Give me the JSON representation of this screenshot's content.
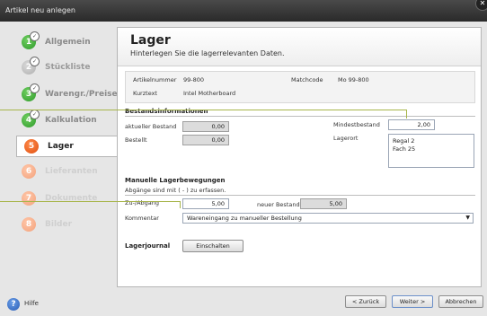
{
  "window": {
    "title": "Artikel neu anlegen"
  },
  "sidebar": {
    "items": [
      {
        "num": "1",
        "label": "Allgemein",
        "state": "done"
      },
      {
        "num": "2",
        "label": "Stückliste",
        "state": "done-grey"
      },
      {
        "num": "3",
        "label": "Warengr./Preise",
        "state": "done"
      },
      {
        "num": "4",
        "label": "Kalkulation",
        "state": "done"
      },
      {
        "num": "5",
        "label": "Lager",
        "state": "current"
      },
      {
        "num": "6",
        "label": "Lieferanten",
        "state": "future"
      },
      {
        "num": "7",
        "label": "Dokumente",
        "state": "future"
      },
      {
        "num": "8",
        "label": "Bilder",
        "state": "future"
      }
    ]
  },
  "header": {
    "title": "Lager",
    "subtitle": "Hinterlegen Sie die lagerrelevanten Daten."
  },
  "article": {
    "number_label": "Artikelnummer",
    "number_value": "99-800",
    "matchcode_label": "Matchcode",
    "matchcode_value": "Mo 99-800",
    "shorttext_label": "Kurztext",
    "shorttext_value": "Intel Motherboard"
  },
  "stock": {
    "section_title": "Bestandsinformationen",
    "current_label": "aktueller Bestand",
    "current_value": "0,00",
    "ordered_label": "Bestellt",
    "ordered_value": "0,00",
    "min_label": "Mindestbestand",
    "min_value": "2,00",
    "location_label": "Lagerort",
    "location_line1": "Regal 2",
    "location_line2": "Fach 25"
  },
  "manual": {
    "section_title": "Manuelle Lagerbewegungen",
    "hint": "Abgänge sind mit ( - ) zu erfassen.",
    "inout_label": "Zu-/Abgang",
    "inout_value": "5,00",
    "new_stock_label": "neuer Bestand",
    "new_stock_value": "5,00",
    "comment_label": "Kommentar",
    "comment_value": "Wareneingang zu manueller Bestellung"
  },
  "journal": {
    "label": "Lagerjournal",
    "button": "Einschalten"
  },
  "footer": {
    "help": "Hilfe",
    "back": "< Zurück",
    "next": "Weiter >",
    "cancel": "Abbrechen"
  }
}
